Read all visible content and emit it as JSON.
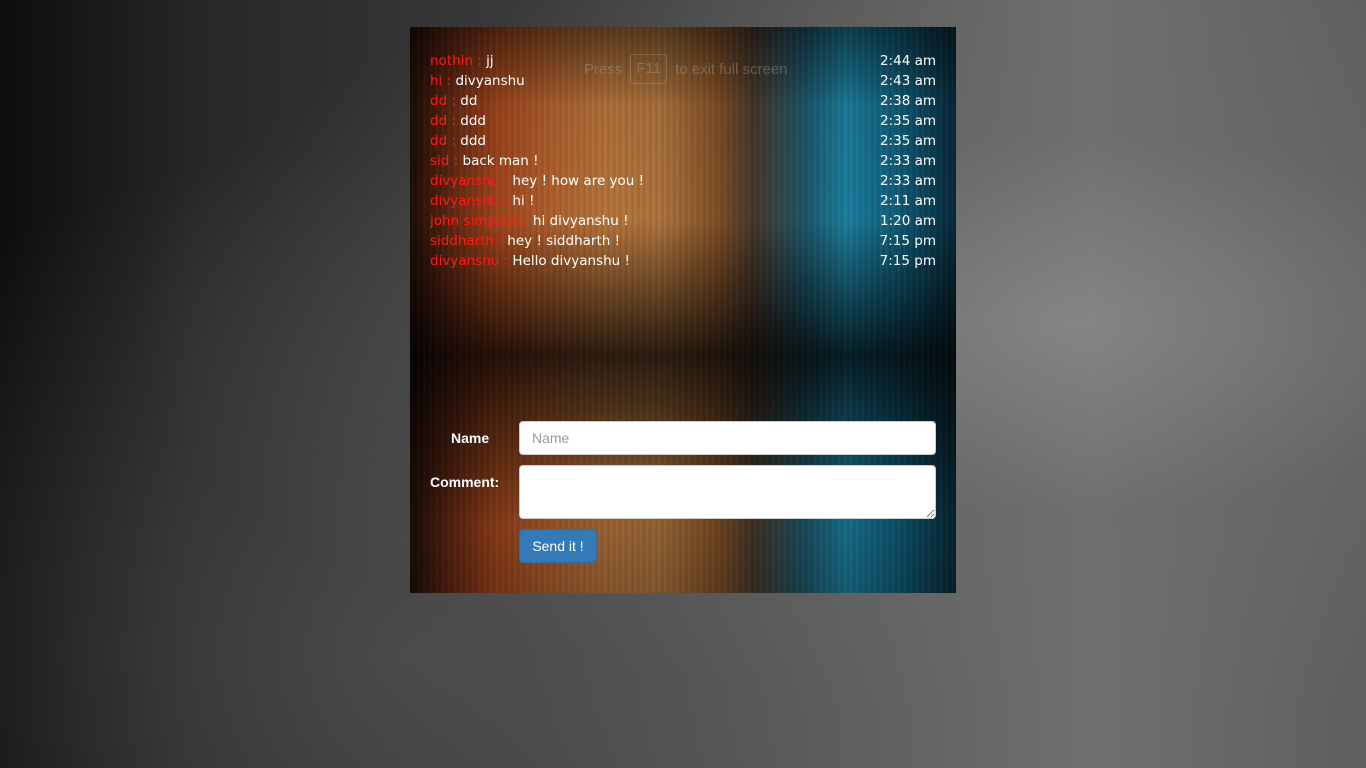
{
  "fullscreen_hint": {
    "prefix": "Press",
    "key": "F11",
    "suffix": "to exit full screen"
  },
  "messages": [
    {
      "author": "nothin",
      "text": "jj",
      "time": "2:44 am"
    },
    {
      "author": "hi",
      "text": "divyanshu",
      "time": "2:43 am"
    },
    {
      "author": "dd",
      "text": "dd",
      "time": "2:38 am"
    },
    {
      "author": "dd",
      "text": "ddd",
      "time": "2:35 am"
    },
    {
      "author": "dd",
      "text": "ddd",
      "time": "2:35 am"
    },
    {
      "author": "sid",
      "text": "back man !",
      "time": "2:33 am"
    },
    {
      "author": "divyanshu",
      "text": "hey ! how are you !",
      "time": "2:33 am"
    },
    {
      "author": "divyanshu",
      "text": "hi !",
      "time": "2:11 am"
    },
    {
      "author": "john simpson",
      "text": "hi divyanshu !",
      "time": "1:20 am"
    },
    {
      "author": "siddharth",
      "text": "hey ! siddharth !",
      "time": "7:15 pm"
    },
    {
      "author": "divyanshu",
      "text": "Hello divyanshu !",
      "time": "7:15 pm"
    }
  ],
  "author_separator": " : ",
  "form": {
    "name_label": "Name",
    "name_placeholder": "Name",
    "name_value": "",
    "comment_label": "Comment:",
    "comment_value": "",
    "submit_label": "Send it !"
  },
  "colors": {
    "author": "#ff1a1a",
    "message_text": "#ffffff",
    "button": "#337ab7"
  }
}
